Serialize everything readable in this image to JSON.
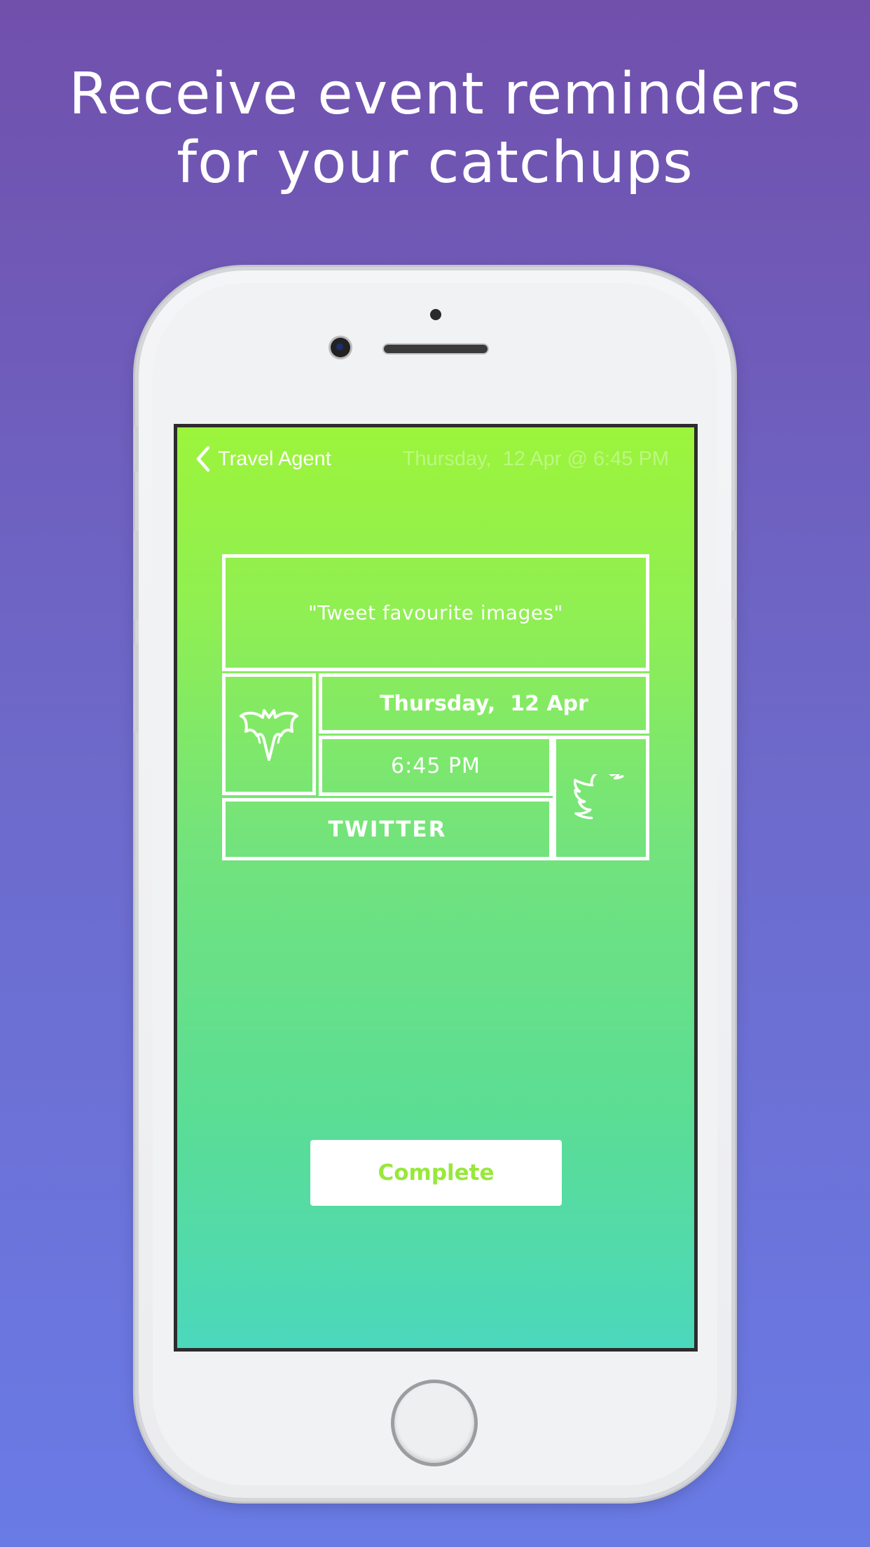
{
  "headline": {
    "line1": "Receive event reminders",
    "line2": "for your catchups"
  },
  "nav": {
    "back_label": "Travel Agent",
    "title": "Thursday,  12 Apr @ 6:45 PM"
  },
  "event": {
    "quote": "\"Tweet favourite images\"",
    "date": "Thursday,  12 Apr",
    "time": "6:45 PM",
    "service": "TWITTER",
    "category_icon": "bat-icon",
    "service_icon": "twitter-bird-icon"
  },
  "actions": {
    "complete_label": "Complete"
  },
  "colors": {
    "background_top": "#7150ac",
    "background_bottom": "#6a7be6",
    "screen_top": "#9cf43b",
    "screen_bottom": "#4bd8bc",
    "accent": "#98e83c"
  }
}
